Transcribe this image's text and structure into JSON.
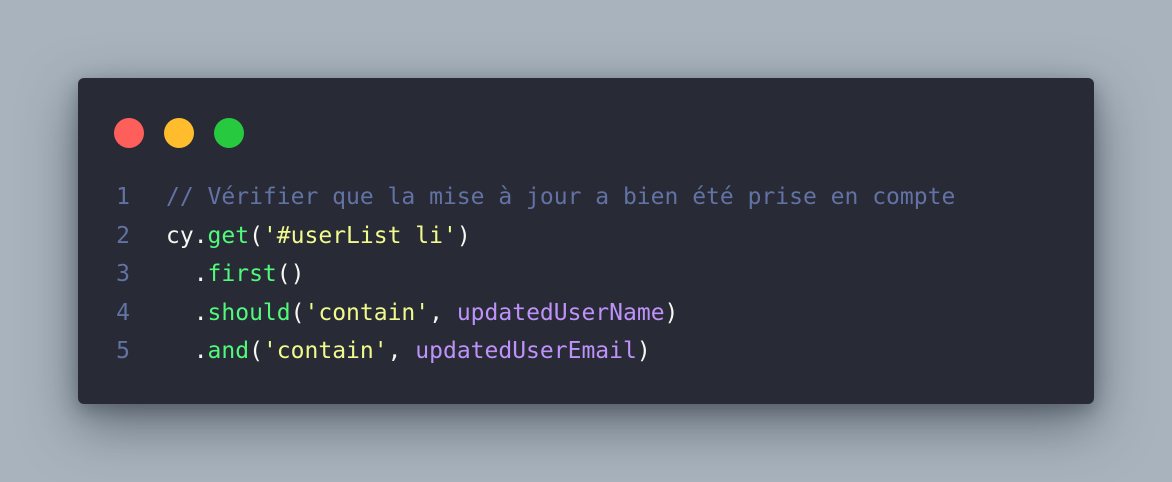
{
  "colors": {
    "background": "#a8b3bd",
    "window": "#282a36",
    "dot_red": "#ff5f5a",
    "dot_yellow": "#ffbd2e",
    "dot_green": "#27c93f",
    "comment": "#6272a4",
    "function": "#50fa7b",
    "string": "#f1fa8c",
    "variable": "#bd93f9",
    "plain": "#f8f8f2"
  },
  "window_controls": [
    "close-dot",
    "minimize-dot",
    "maximize-dot"
  ],
  "code_lines": [
    {
      "number": "1",
      "tokens": [
        {
          "type": "comment",
          "text": "// Vérifier que la mise à jour a bien été prise en compte"
        }
      ]
    },
    {
      "number": "2",
      "tokens": [
        {
          "type": "plain",
          "text": "cy."
        },
        {
          "type": "fn",
          "text": "get"
        },
        {
          "type": "plain",
          "text": "("
        },
        {
          "type": "str",
          "text": "'#userList li'"
        },
        {
          "type": "plain",
          "text": ")"
        }
      ]
    },
    {
      "number": "3",
      "tokens": [
        {
          "type": "plain",
          "text": "  ."
        },
        {
          "type": "fn",
          "text": "first"
        },
        {
          "type": "plain",
          "text": "()"
        }
      ]
    },
    {
      "number": "4",
      "tokens": [
        {
          "type": "plain",
          "text": "  ."
        },
        {
          "type": "fn",
          "text": "should"
        },
        {
          "type": "plain",
          "text": "("
        },
        {
          "type": "str",
          "text": "'contain'"
        },
        {
          "type": "plain",
          "text": ", "
        },
        {
          "type": "var",
          "text": "updatedUserName"
        },
        {
          "type": "plain",
          "text": ")"
        }
      ]
    },
    {
      "number": "5",
      "tokens": [
        {
          "type": "plain",
          "text": "  ."
        },
        {
          "type": "fn",
          "text": "and"
        },
        {
          "type": "plain",
          "text": "("
        },
        {
          "type": "str",
          "text": "'contain'"
        },
        {
          "type": "plain",
          "text": ", "
        },
        {
          "type": "var",
          "text": "updatedUserEmail"
        },
        {
          "type": "plain",
          "text": ")"
        }
      ]
    }
  ]
}
